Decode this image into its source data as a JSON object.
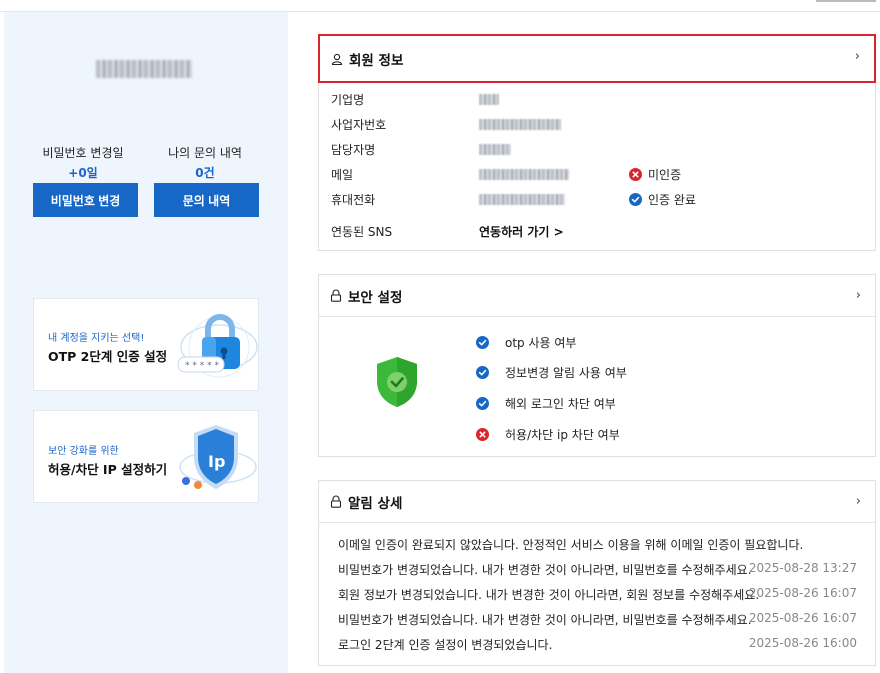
{
  "sidebar": {
    "password_changed_label": "비밀번호 변경일",
    "password_changed_value": "+0일",
    "inquiry_label": "나의 문의 내역",
    "inquiry_value": "0건",
    "change_password_button": "비밀번호 변경",
    "inquiry_button": "문의 내역",
    "promo_otp": {
      "sub": "내 계정을 지키는 선택!",
      "main": "OTP 2단계 인증 설정",
      "icon": "lock-icon"
    },
    "promo_ip": {
      "sub": "보안 강화를 위한",
      "main": "허용/차단 IP 설정하기",
      "icon": "ip-shield-icon"
    }
  },
  "member_info": {
    "title": "회원 정보",
    "rows": [
      {
        "label": "기업명"
      },
      {
        "label": "사업자번호"
      },
      {
        "label": "담당자명"
      },
      {
        "label": "메일",
        "status": "미인증",
        "status_type": "error"
      },
      {
        "label": "휴대전화",
        "status": "인증 완료",
        "status_type": "ok"
      },
      {
        "label": "연동된 SNS",
        "link": "연동하러 가기 >"
      }
    ]
  },
  "security": {
    "title": "보안 설정",
    "items": [
      {
        "label": "otp 사용 여부",
        "state": "ok"
      },
      {
        "label": "정보변경 알림 사용 여부",
        "state": "ok"
      },
      {
        "label": "해외 로그인 차단 여부",
        "state": "ok"
      },
      {
        "label": "허용/차단 ip 차단 여부",
        "state": "error"
      }
    ]
  },
  "notifications": {
    "title": "알림 상세",
    "items": [
      {
        "text": "이메일 인증이 완료되지 않았습니다. 안정적인 서비스 이용을 위해 이메일 인증이 필요합니다.",
        "date": ""
      },
      {
        "text": "비밀번호가 변경되었습니다. 내가 변경한 것이 아니라면, 비밀번호를 수정해주세요.",
        "date": "2025-08-28 13:27"
      },
      {
        "text": "회원 정보가 변경되었습니다. 내가 변경한 것이 아니라면, 회원 정보를 수정해주세요.",
        "date": "2025-08-26 16:07"
      },
      {
        "text": "비밀번호가 변경되었습니다. 내가 변경한 것이 아니라면, 비밀번호를 수정해주세요.",
        "date": "2025-08-26 16:07"
      },
      {
        "text": "로그인 2단계 인증 설정이 변경되었습니다.",
        "date": "2025-08-26 16:00"
      }
    ]
  },
  "colors": {
    "accent": "#1767c7",
    "ok": "#1767c7",
    "error": "#d8262e",
    "shield": "#3cb83a",
    "highlight": "#d8262e"
  }
}
